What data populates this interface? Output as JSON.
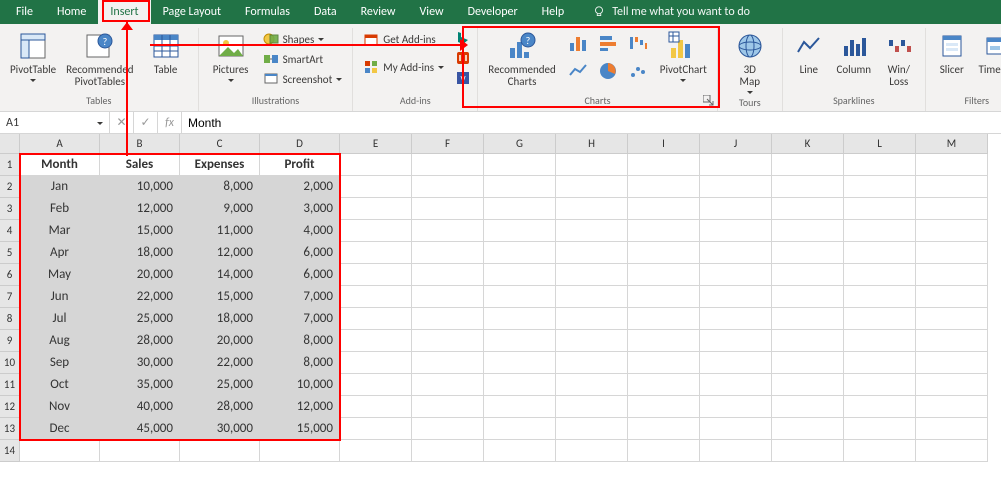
{
  "menu": [
    "File",
    "Home",
    "Insert",
    "Page Layout",
    "Formulas",
    "Data",
    "Review",
    "View",
    "Developer",
    "Help"
  ],
  "tellme": "Tell me what you want to do",
  "ribbon": {
    "tables": {
      "pivottable": "PivotTable",
      "recommended": "Recommended\nPivotTables",
      "table": "Table",
      "label": "Tables"
    },
    "illustrations": {
      "pictures": "Pictures",
      "shapes": "Shapes",
      "smartart": "SmartArt",
      "screenshot": "Screenshot",
      "label": "Illustrations"
    },
    "addins": {
      "get": "Get Add-ins",
      "my": "My Add-ins",
      "label": "Add-ins"
    },
    "charts": {
      "recommended": "Recommended\nCharts",
      "pivotchart": "PivotChart",
      "label": "Charts"
    },
    "tours": {
      "map": "3D\nMap",
      "label": "Tours"
    },
    "sparklines": {
      "line": "Line",
      "column": "Column",
      "winloss": "Win/\nLoss",
      "label": "Sparklines"
    },
    "filters": {
      "slicer": "Slicer",
      "timeline": "Timeline",
      "label": "Filters"
    }
  },
  "namebox": "A1",
  "formula": "Month",
  "columns": [
    "A",
    "B",
    "C",
    "D",
    "E",
    "F",
    "G",
    "H",
    "I",
    "J",
    "K",
    "L",
    "M"
  ],
  "headers": [
    "Month",
    "Sales",
    "Expenses",
    "Profit"
  ],
  "data": [
    [
      "Jan",
      "10,000",
      "8,000",
      "2,000"
    ],
    [
      "Feb",
      "12,000",
      "9,000",
      "3,000"
    ],
    [
      "Mar",
      "15,000",
      "11,000",
      "4,000"
    ],
    [
      "Apr",
      "18,000",
      "12,000",
      "6,000"
    ],
    [
      "May",
      "20,000",
      "14,000",
      "6,000"
    ],
    [
      "Jun",
      "22,000",
      "15,000",
      "7,000"
    ],
    [
      "Jul",
      "25,000",
      "18,000",
      "7,000"
    ],
    [
      "Aug",
      "28,000",
      "20,000",
      "8,000"
    ],
    [
      "Sep",
      "30,000",
      "22,000",
      "8,000"
    ],
    [
      "Oct",
      "35,000",
      "25,000",
      "10,000"
    ],
    [
      "Nov",
      "40,000",
      "28,000",
      "12,000"
    ],
    [
      "Dec",
      "45,000",
      "30,000",
      "15,000"
    ]
  ]
}
